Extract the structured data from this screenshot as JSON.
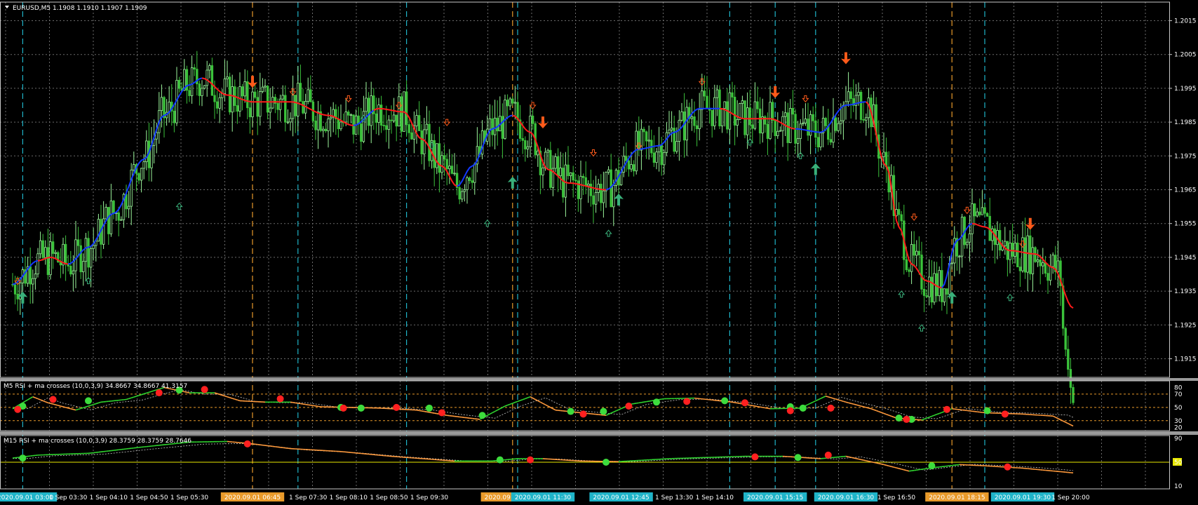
{
  "window": {
    "symbol_header": "EURUSD,M5  1.1908 1.1910 1.1907 1.1909"
  },
  "colors": {
    "background": "#000000",
    "grid": "#6b6b6b",
    "frame": "#c8c8c8",
    "bull_candle": "#9cf59c",
    "bear_candle": "#3bc23b",
    "ma_up": "#1238ff",
    "ma_down": "#ff1a1a",
    "cyan_line": "#1fb4c8",
    "orange_line": "#e89a2a",
    "arrow_up": "#39b07a",
    "arrow_down": "#ff5a1a",
    "rsi_up": "#2fd42f",
    "rsi_down": "#ff9a3c",
    "dot_green": "#3ddc3d",
    "dot_red": "#ff2020",
    "level_yellow": "#e8e800"
  },
  "main_chart": {
    "price_labels": [
      "1.2015",
      "1.2005",
      "1.1995",
      "1.1985",
      "1.1975",
      "1.1965",
      "1.1955",
      "1.1945",
      "1.1935",
      "1.1925",
      "1.1915"
    ],
    "price_values": [
      1.2015,
      1.2005,
      1.1995,
      1.1985,
      1.1975,
      1.1965,
      1.1955,
      1.1945,
      1.1935,
      1.1925,
      1.1915
    ],
    "ylim": [
      1.19095,
      1.20205
    ]
  },
  "chart_data": {
    "type": "candlestick",
    "ma_keypoints": [
      [
        0,
        1.1937
      ],
      [
        10,
        1.1944
      ],
      [
        15,
        1.1945
      ],
      [
        22,
        1.1943
      ],
      [
        30,
        1.1948
      ],
      [
        40,
        1.1958
      ],
      [
        52,
        1.1974
      ],
      [
        60,
        1.1987
      ],
      [
        70,
        1.1996
      ],
      [
        75,
        1.1998
      ],
      [
        85,
        1.1993
      ],
      [
        95,
        1.1991
      ],
      [
        110,
        1.1991
      ],
      [
        125,
        1.1987
      ],
      [
        135,
        1.1984
      ],
      [
        145,
        1.1989
      ],
      [
        155,
        1.1988
      ],
      [
        162,
        1.198
      ],
      [
        170,
        1.1972
      ],
      [
        176,
        1.1966
      ],
      [
        182,
        1.1972
      ],
      [
        190,
        1.1983
      ],
      [
        198,
        1.1987
      ],
      [
        205,
        1.1982
      ],
      [
        212,
        1.1971
      ],
      [
        220,
        1.1967
      ],
      [
        235,
        1.1965
      ],
      [
        248,
        1.1977
      ],
      [
        256,
        1.1978
      ],
      [
        262,
        1.1982
      ],
      [
        272,
        1.1989
      ],
      [
        280,
        1.1989
      ],
      [
        290,
        1.1986
      ],
      [
        300,
        1.1986
      ],
      [
        310,
        1.1983
      ],
      [
        320,
        1.1982
      ],
      [
        330,
        1.199
      ],
      [
        338,
        1.1991
      ],
      [
        346,
        1.1972
      ],
      [
        351,
        1.1954
      ],
      [
        356,
        1.1943
      ],
      [
        362,
        1.1938
      ],
      [
        368,
        1.1936
      ],
      [
        374,
        1.195
      ],
      [
        380,
        1.1955
      ],
      [
        385,
        1.1954
      ],
      [
        395,
        1.1947
      ],
      [
        405,
        1.1946
      ],
      [
        412,
        1.1942
      ],
      [
        420,
        1.193
      ]
    ],
    "ma_down_segments": [
      [
        10,
        22
      ],
      [
        75,
        135
      ],
      [
        143,
        176
      ],
      [
        198,
        235
      ],
      [
        280,
        310
      ],
      [
        338,
        368
      ],
      [
        380,
        420
      ]
    ],
    "vertical_cyan_bar_index": [
      4,
      113,
      156,
      200,
      284,
      302,
      318,
      385
    ],
    "vertical_orange_bar_index": [
      95,
      198,
      372
    ],
    "arrows_up_big": [
      [
        4,
        1.1933
      ],
      [
        198,
        1.1967
      ],
      [
        240,
        1.1962
      ],
      [
        318,
        1.1971
      ],
      [
        372,
        1.1933
      ]
    ],
    "arrows_down_big": [
      [
        95,
        1.1997
      ],
      [
        210,
        1.1985
      ],
      [
        302,
        1.1994
      ],
      [
        330,
        1.2004
      ],
      [
        403,
        1.1955
      ]
    ],
    "arrows_up_small": [
      [
        30,
        1.1938
      ],
      [
        66,
        1.196
      ],
      [
        139,
        1.1986
      ],
      [
        166,
        1.1978
      ],
      [
        188,
        1.1955
      ],
      [
        236,
        1.1952
      ],
      [
        292,
        1.1979
      ],
      [
        312,
        1.1975
      ],
      [
        352,
        1.1934
      ],
      [
        360,
        1.1924
      ],
      [
        395,
        1.1933
      ]
    ],
    "arrows_down_small": [
      [
        2,
        1.1938
      ],
      [
        111,
        1.1994
      ],
      [
        133,
        1.1992
      ],
      [
        153,
        1.199
      ],
      [
        172,
        1.1985
      ],
      [
        206,
        1.199
      ],
      [
        230,
        1.1976
      ],
      [
        248,
        1.1978
      ],
      [
        273,
        1.1997
      ],
      [
        314,
        1.1992
      ],
      [
        357,
        1.1957
      ],
      [
        378,
        1.1959
      ],
      [
        400,
        1.1949
      ]
    ],
    "rsi_m5": {
      "title": "M5 RSI + ma crosses (10,0,3,9) 34.8667 34.8667 41.3157",
      "levels": [
        70,
        50,
        30
      ],
      "axis_labels": [
        "80",
        "70",
        "50",
        "30",
        "20"
      ],
      "keypoints": [
        [
          0,
          48
        ],
        [
          8,
          66
        ],
        [
          14,
          57
        ],
        [
          25,
          46
        ],
        [
          35,
          58
        ],
        [
          45,
          62
        ],
        [
          60,
          80
        ],
        [
          70,
          72
        ],
        [
          80,
          72
        ],
        [
          90,
          60
        ],
        [
          100,
          58
        ],
        [
          110,
          58
        ],
        [
          122,
          51
        ],
        [
          133,
          50
        ],
        [
          145,
          49
        ],
        [
          160,
          46
        ],
        [
          172,
          38
        ],
        [
          185,
          32
        ],
        [
          195,
          52
        ],
        [
          205,
          66
        ],
        [
          215,
          46
        ],
        [
          225,
          42
        ],
        [
          235,
          38
        ],
        [
          245,
          55
        ],
        [
          258,
          63
        ],
        [
          270,
          64
        ],
        [
          285,
          58
        ],
        [
          300,
          48
        ],
        [
          312,
          49
        ],
        [
          322,
          67
        ],
        [
          330,
          58
        ],
        [
          340,
          48
        ],
        [
          350,
          34
        ],
        [
          360,
          31
        ],
        [
          372,
          48
        ],
        [
          385,
          42
        ],
        [
          400,
          40
        ],
        [
          412,
          37
        ],
        [
          420,
          22
        ]
      ],
      "dots_green": [
        [
          4,
          52
        ],
        [
          30,
          60
        ],
        [
          66,
          76
        ],
        [
          130,
          50
        ],
        [
          138,
          49
        ],
        [
          165,
          49
        ],
        [
          186,
          38
        ],
        [
          221,
          44
        ],
        [
          234,
          44
        ],
        [
          255,
          58
        ],
        [
          282,
          60
        ],
        [
          308,
          51
        ],
        [
          313,
          49
        ],
        [
          351,
          34
        ],
        [
          356,
          32
        ],
        [
          386,
          45
        ]
      ],
      "dots_red": [
        [
          2,
          47
        ],
        [
          16,
          62
        ],
        [
          58,
          72
        ],
        [
          76,
          77
        ],
        [
          106,
          63
        ],
        [
          131,
          49
        ],
        [
          152,
          50
        ],
        [
          170,
          42
        ],
        [
          226,
          40
        ],
        [
          244,
          52
        ],
        [
          267,
          59
        ],
        [
          290,
          57
        ],
        [
          308,
          45
        ],
        [
          324,
          49
        ],
        [
          354,
          32
        ],
        [
          370,
          47
        ],
        [
          393,
          40
        ]
      ]
    },
    "rsi_m15": {
      "title": "M15 RSI + ma crosses (10,0,3,9) 28.3759 28.3759 28.7646",
      "level": 50,
      "axis_labels": [
        "90",
        "50",
        "10"
      ],
      "keypoints": [
        [
          0,
          57
        ],
        [
          10,
          62
        ],
        [
          30,
          65
        ],
        [
          50,
          75
        ],
        [
          70,
          84
        ],
        [
          85,
          85
        ],
        [
          95,
          81
        ],
        [
          110,
          73
        ],
        [
          130,
          68
        ],
        [
          150,
          60
        ],
        [
          175,
          52
        ],
        [
          190,
          52
        ],
        [
          200,
          56
        ],
        [
          210,
          56
        ],
        [
          225,
          52
        ],
        [
          240,
          51
        ],
        [
          260,
          56
        ],
        [
          290,
          60
        ],
        [
          305,
          60
        ],
        [
          320,
          56
        ],
        [
          330,
          60
        ],
        [
          345,
          46
        ],
        [
          355,
          35
        ],
        [
          365,
          41
        ],
        [
          375,
          46
        ],
        [
          385,
          44
        ],
        [
          400,
          40
        ],
        [
          420,
          32
        ]
      ],
      "dots_green": [
        [
          4,
          57
        ],
        [
          193,
          54
        ],
        [
          235,
          50
        ],
        [
          311,
          58
        ],
        [
          364,
          44
        ]
      ],
      "dots_red": [
        [
          93,
          81
        ],
        [
          205,
          54
        ],
        [
          294,
          59
        ],
        [
          323,
          62
        ],
        [
          394,
          42
        ]
      ]
    },
    "time_labels": [
      {
        "i": 5,
        "text": "2020.09.01 03:00",
        "hl": "cyan"
      },
      {
        "i": 22,
        "text": "1 Sep 03:30"
      },
      {
        "i": 38,
        "text": "1 Sep 04:10"
      },
      {
        "i": 54,
        "text": "1 Sep 04:50"
      },
      {
        "i": 70,
        "text": "1 Sep 05:30"
      },
      {
        "i": 95,
        "text": "2020.09.01 06:45",
        "hl": "orange"
      },
      {
        "i": 117,
        "text": "1 Sep 07:30"
      },
      {
        "i": 133,
        "text": "1 Sep 08:10"
      },
      {
        "i": 149,
        "text": "1 Sep 08:50"
      },
      {
        "i": 165,
        "text": "1 Sep 09:30"
      },
      {
        "i": 198,
        "text": "2020.09.01 11:00",
        "hl": "orange"
      },
      {
        "i": 210,
        "text": "2020.09.01 11:30",
        "hl": "cyan"
      },
      {
        "i": 241,
        "text": "2020.09.01 12:45",
        "hl": "cyan"
      },
      {
        "i": 262,
        "text": "1 Sep 13:30"
      },
      {
        "i": 278,
        "text": "1 Sep 14:10"
      },
      {
        "i": 302,
        "text": "2020.09.01 15:15",
        "hl": "cyan"
      },
      {
        "i": 330,
        "text": "2020.09.01 16:30",
        "hl": "cyan"
      },
      {
        "i": 350,
        "text": "1 Sep 16:50"
      },
      {
        "i": 374,
        "text": "2020.09.01 18:15",
        "hl": "orange"
      },
      {
        "i": 400,
        "text": "2020.09.01 19:30",
        "hl": "cyan"
      },
      {
        "i": 419,
        "text": "1 Sep 20:00"
      }
    ]
  }
}
